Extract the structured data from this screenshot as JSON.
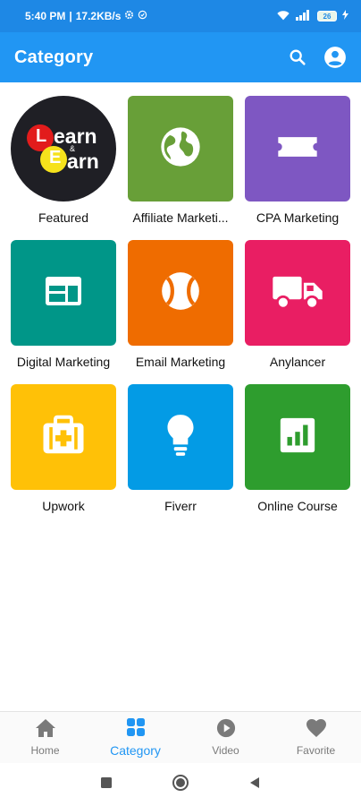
{
  "status_bar": {
    "time": "5:40 PM",
    "separator": "|",
    "speed": "17.2KB/s",
    "battery": "26"
  },
  "app_bar": {
    "title": "Category",
    "icons": [
      "search-icon",
      "account-circle-icon"
    ]
  },
  "logo": {
    "letter_l": "L",
    "word_1": "earn",
    "amp": "&",
    "letter_e": "E",
    "word_2": "arn"
  },
  "categories": [
    {
      "label": "Featured",
      "icon": "learn-and-earn-logo",
      "color": "#1f1f25"
    },
    {
      "label": "Affiliate Marketi...",
      "icon": "globe-icon",
      "color": "#689f38"
    },
    {
      "label": "CPA Marketing",
      "icon": "ticket-icon",
      "color": "#7e57c2"
    },
    {
      "label": "Digital Marketing",
      "icon": "web-layout-icon",
      "color": "#009688"
    },
    {
      "label": "Email Marketing",
      "icon": "tennis-ball-icon",
      "color": "#ef6c00"
    },
    {
      "label": "Anylancer",
      "icon": "truck-icon",
      "color": "#e91e63"
    },
    {
      "label": "Upwork",
      "icon": "medical-bag-icon",
      "color": "#ffc107"
    },
    {
      "label": "Fiverr",
      "icon": "lightbulb-icon",
      "color": "#039be5"
    },
    {
      "label": "Online Course",
      "icon": "chart-icon",
      "color": "#2e9d2e"
    }
  ],
  "bottom_nav": [
    {
      "label": "Home",
      "icon": "home-icon",
      "active": false
    },
    {
      "label": "Category",
      "icon": "category-icon",
      "active": true
    },
    {
      "label": "Video",
      "icon": "play-circle-icon",
      "active": false
    },
    {
      "label": "Favorite",
      "icon": "heart-icon",
      "active": false
    }
  ],
  "colors": {
    "primary": "#2196f3",
    "status_bar": "#1e88e5",
    "inactive_nav": "#7a7a7a"
  }
}
